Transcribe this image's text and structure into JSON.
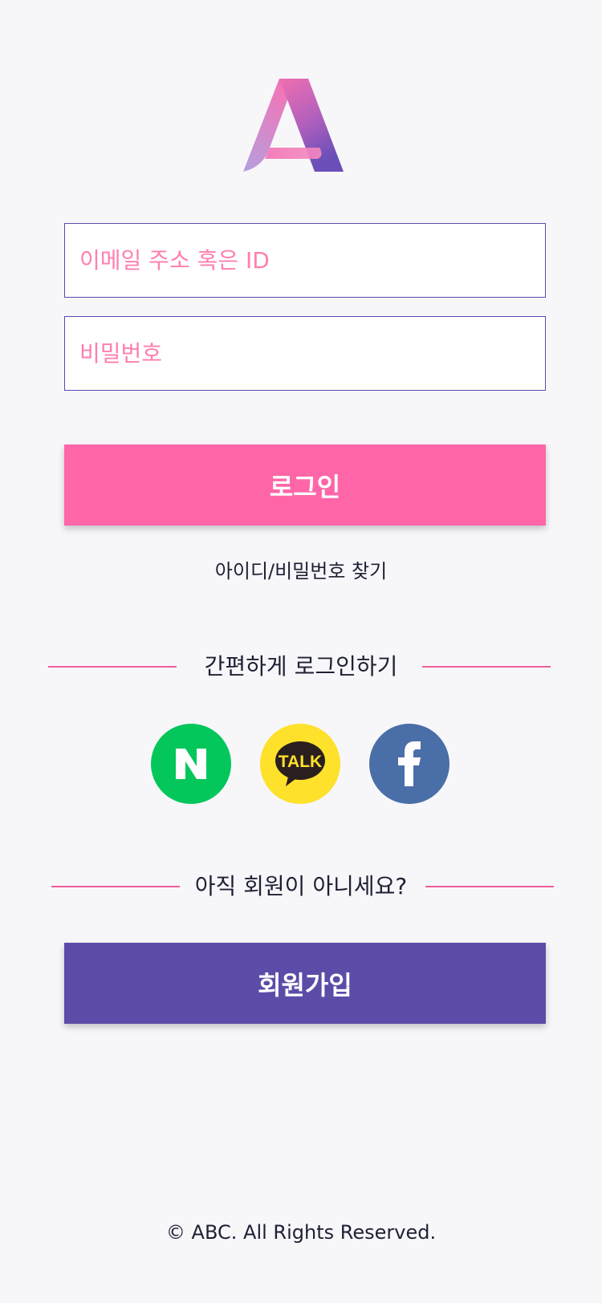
{
  "login_form": {
    "email_placeholder": "이메일 주소 혹은 ID",
    "password_placeholder": "비밀번호",
    "login_button_label": "로그인",
    "find_account_link": "아이디/비밀번호 찾기"
  },
  "social_login": {
    "heading": "간편하게 로그인하기",
    "providers": [
      {
        "name": "naver",
        "icon": "naver-icon",
        "glyph": "N",
        "color": "#03c75a"
      },
      {
        "name": "kakao",
        "icon": "kakao-talk-icon",
        "glyph": "TALK",
        "color": "#fee12b"
      },
      {
        "name": "facebook",
        "icon": "facebook-icon",
        "glyph": "f",
        "color": "#4a6ea8"
      }
    ]
  },
  "signup": {
    "heading": "아직 회원이 아니세요?",
    "button_label": "회원가입"
  },
  "footer": {
    "copyright": "© ABC. All Rights Reserved."
  },
  "colors": {
    "background": "#f7f7fa",
    "accent_pink": "#ff66a8",
    "accent_purple": "#5c4ca8",
    "divider": "#f25c9a",
    "placeholder": "#ff7eb0"
  }
}
